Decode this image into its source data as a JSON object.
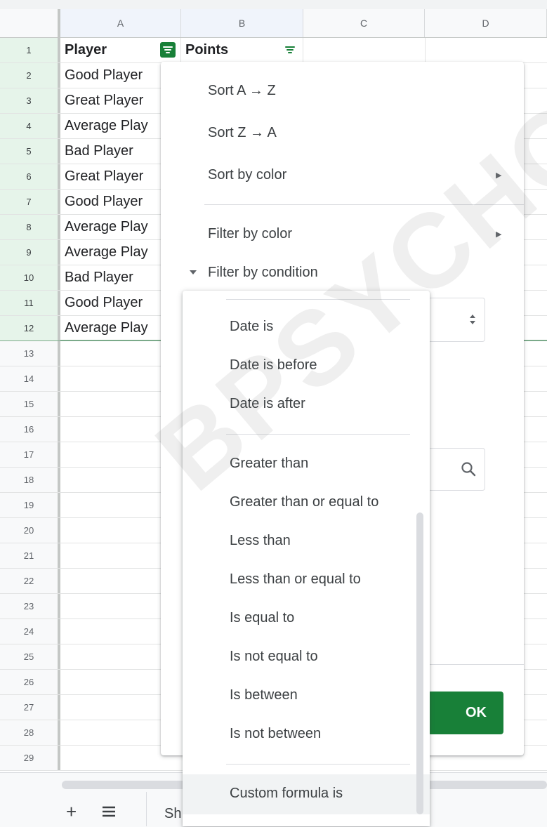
{
  "columns": [
    "A",
    "B",
    "C",
    "D"
  ],
  "header_row": {
    "a": "Player",
    "b": "Points"
  },
  "rows": [
    {
      "n": "1"
    },
    {
      "n": "2",
      "a": "Good Player"
    },
    {
      "n": "3",
      "a": "Great Player"
    },
    {
      "n": "4",
      "a": "Average Play"
    },
    {
      "n": "5",
      "a": "Bad Player"
    },
    {
      "n": "6",
      "a": "Great Player"
    },
    {
      "n": "7",
      "a": "Good Player"
    },
    {
      "n": "8",
      "a": "Average Play"
    },
    {
      "n": "9",
      "a": "Average Play"
    },
    {
      "n": "10",
      "a": "Bad Player"
    },
    {
      "n": "11",
      "a": "Good Player"
    },
    {
      "n": "12",
      "a": "Average Play"
    },
    {
      "n": "13"
    },
    {
      "n": "14"
    },
    {
      "n": "15"
    },
    {
      "n": "16"
    },
    {
      "n": "17"
    },
    {
      "n": "18"
    },
    {
      "n": "19"
    },
    {
      "n": "20"
    },
    {
      "n": "21"
    },
    {
      "n": "22"
    },
    {
      "n": "23"
    },
    {
      "n": "24"
    },
    {
      "n": "25"
    },
    {
      "n": "26"
    },
    {
      "n": "27"
    },
    {
      "n": "28"
    },
    {
      "n": "29"
    }
  ],
  "filter_menu": {
    "sort_az": "Sort A → Z",
    "sort_za": "Sort Z → A",
    "sort_by_color": "Sort by color",
    "filter_by_color": "Filter by color",
    "filter_by_condition": "Filter by condition",
    "ok": "OK"
  },
  "condition_options": [
    "Date is",
    "Date is before",
    "Date is after",
    "Greater than",
    "Greater than or equal to",
    "Less than",
    "Less than or equal to",
    "Is equal to",
    "Is not equal to",
    "Is between",
    "Is not between",
    "Custom formula is"
  ],
  "bottom_bar": {
    "sheet_tab": "Sh"
  },
  "watermark": "BPSYCHOL",
  "colors": {
    "accent_green": "#188038",
    "menu_text": "#3c4043",
    "header_bg": "#f8f9fa"
  }
}
